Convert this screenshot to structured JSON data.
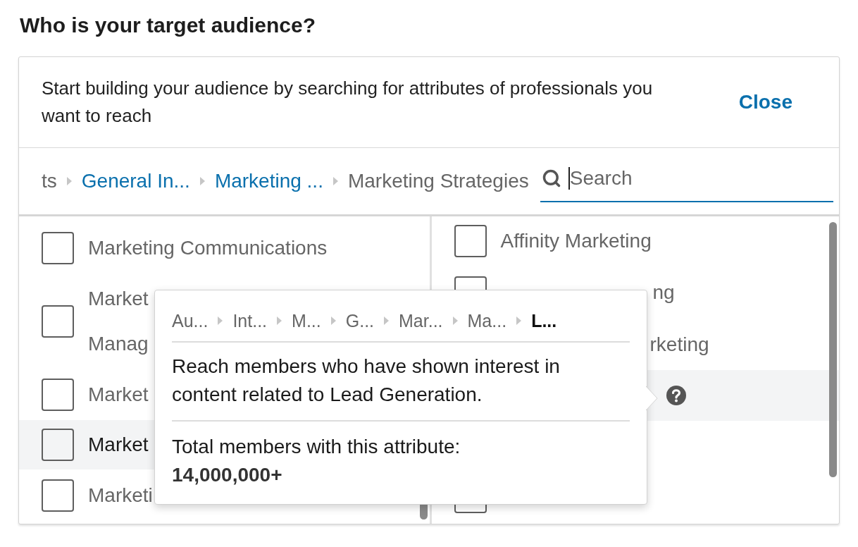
{
  "title": "Who is your target audience?",
  "panel": {
    "intro": "Start building your audience by searching for attributes of professionals you want to reach",
    "close": "Close",
    "breadcrumb": [
      {
        "label": "ts",
        "link": false
      },
      {
        "label": "General In...",
        "link": true
      },
      {
        "label": "Marketing ...",
        "link": true
      },
      {
        "label": "Marketing Strategies",
        "link": false
      }
    ],
    "search": {
      "placeholder": "Search",
      "focused": true
    },
    "left_items": [
      {
        "kind": "item",
        "lines": [
          "Marketing Communications"
        ],
        "highlighted": false,
        "checked": false
      },
      {
        "kind": "item",
        "lines": [
          "Market",
          "Manag"
        ],
        "highlighted": false,
        "checked": false
      },
      {
        "kind": "item",
        "lines": [
          "Market"
        ],
        "highlighted": false,
        "checked": false
      },
      {
        "kind": "item",
        "lines": [
          "Market"
        ],
        "highlighted": true,
        "checked": false
      },
      {
        "kind": "item",
        "lines": [
          "Marketi"
        ],
        "highlighted": false,
        "checked": false
      }
    ],
    "right_items": [
      {
        "kind": "item",
        "lines": [
          "Affinity Marketing"
        ],
        "highlighted": false,
        "checked": false
      },
      {
        "kind": "covered",
        "lines": [
          "ng"
        ],
        "highlighted": false,
        "checked": false
      },
      {
        "kind": "covered-text",
        "lines": [
          "rketing"
        ],
        "highlighted": false
      },
      {
        "kind": "help",
        "highlighted": true
      },
      {
        "kind": "hidden",
        "highlighted": false
      },
      {
        "kind": "item",
        "highlighted": false,
        "checked": false
      }
    ],
    "popover": {
      "path": [
        {
          "label": "Au...",
          "current": false
        },
        {
          "label": "Int...",
          "current": false
        },
        {
          "label": "M...",
          "current": false
        },
        {
          "label": "G...",
          "current": false
        },
        {
          "label": "Mar...",
          "current": false
        },
        {
          "label": "Ma...",
          "current": false
        },
        {
          "label": "L...",
          "current": true
        }
      ],
      "description": "Reach members who have shown interest in content related to Lead Generation.",
      "total_label": "Total members with this attribute:",
      "total": "14,000,000+"
    }
  }
}
